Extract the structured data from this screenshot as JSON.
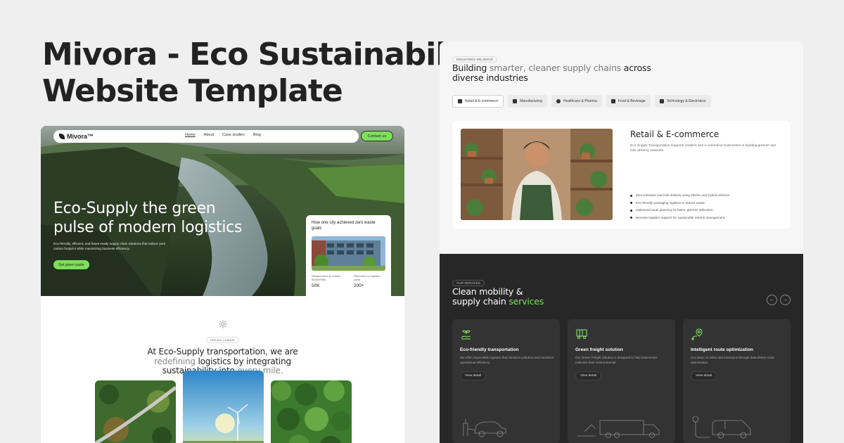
{
  "banner": {
    "line1": "Mivora - Eco Sustainability",
    "line2": "Website Template"
  },
  "left": {
    "nav": {
      "logo": "Mivora™",
      "links": [
        "Home",
        "About",
        "Case studies",
        "Blog"
      ],
      "contact": "Contact us"
    },
    "hero": {
      "title_line1": "Eco-Supply the green",
      "title_line2": "pulse of modern logistics",
      "subtitle": "Eco-friendly, efficient, and future-ready supply chain solutions that reduce your carbon footprint while maximizing business efficiency.",
      "cta": "Get green quote"
    },
    "case_card": {
      "title": "How one city achieved zero waste goals",
      "stat1_label": "Planted trees to restore biodiversity",
      "stat1_value": "50K",
      "stat2_label": "Reduction in logistics costs",
      "stat2_value": "200+"
    },
    "mission": {
      "tag": "DRIVING CHANGE",
      "line1": "At Eco-Supply transportation, we are",
      "line2_muted": "redefining",
      "line2_rest": " logistics by integrating",
      "line3_rest": "sustainability into ",
      "line3_muted": "every mile."
    }
  },
  "right": {
    "industries": {
      "tag": "INDUSTRIES WE SERVE",
      "h_part1": "Building ",
      "h_part2_muted": "smarter, cleaner supply chains",
      "h_part3": " across",
      "h_line2": "diverse industries",
      "tabs": [
        {
          "label": "Retail & E-commerce",
          "icon": "store-icon"
        },
        {
          "label": "Manufacturing",
          "icon": "factory-icon"
        },
        {
          "label": "Healthcare & Pharma",
          "icon": "pill-icon"
        },
        {
          "label": "Food & Beverage",
          "icon": "food-icon"
        },
        {
          "label": "Technology & Electronics",
          "icon": "chip-icon"
        }
      ],
      "card_title": "Retail & E-commerce",
      "card_desc": "Eco-Supply Transportation supports retailers and e-commerce businesses in building greener last mile delivery networks.",
      "bullets": [
        "Zero-emission last-mile delivery using electric and hybrid vehicles.",
        "Eco-friendly packaging logistics to reduce waste.",
        "Optimized route planning for faster, greener deliveries.",
        "Reverse logistics support for sustainable returns management."
      ]
    },
    "services": {
      "tag": "OUR SERVICES",
      "h_line1": "Clean mobility &",
      "h_line2": "supply chain ",
      "h_accent": "services",
      "prev": "←",
      "next": "→",
      "cards": [
        {
          "title": "Eco-friendly transportation",
          "desc": "We offer responsible logistics that minimize pollution and maximize operational efficiency.",
          "btn": "View detail"
        },
        {
          "title": "Green freight solution",
          "desc": "Our Green Freight Solution is designed to help businesses minimize their environmental.",
          "btn": "View detail"
        },
        {
          "title": "Intelligent route optimization",
          "desc": "Cut down on miles and emissions through data-driven route optimization.",
          "btn": "View detail"
        }
      ]
    }
  },
  "colors": {
    "accent": "#7ee05a",
    "dark": "#272727",
    "bg": "#efefef"
  }
}
